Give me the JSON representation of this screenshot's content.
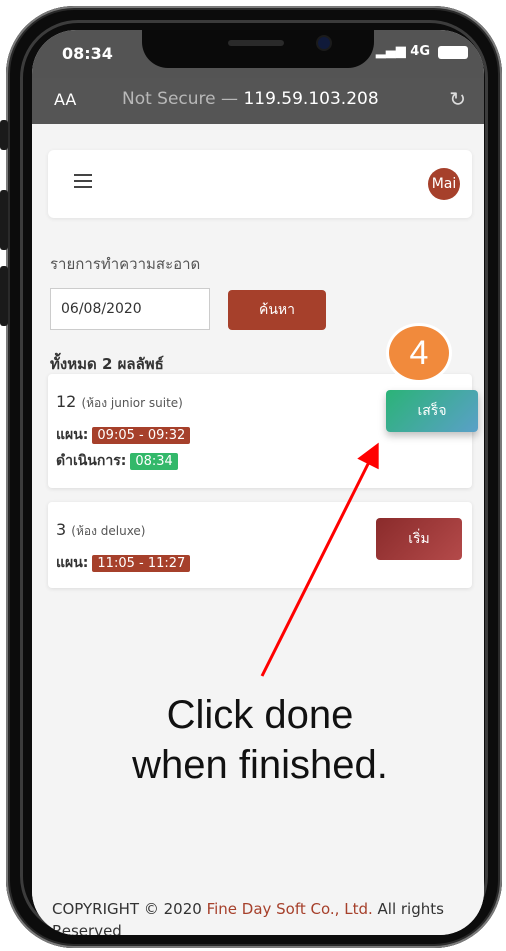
{
  "status_bar": {
    "time": "08:34",
    "network": "4G"
  },
  "browser": {
    "text_size_label": "AA",
    "security": "Not Secure",
    "separator": " — ",
    "address": "119.59.103.208"
  },
  "header": {
    "avatar_label": "Mai"
  },
  "page": {
    "title": "รายการทำความสะอาด",
    "date_value": "06/08/2020",
    "search_label": "ค้นหา",
    "total_label": "ทั้งหมด 2 ผลลัพธ์"
  },
  "tasks": [
    {
      "room": "12",
      "room_type": "(ห้อง junior suite)",
      "plan_label": "แผน:",
      "plan_time": "09:05 - 09:32",
      "progress_label": "ดำเนินการ:",
      "progress_time": "08:34",
      "action_label": "เสร็จ"
    },
    {
      "room": "3",
      "room_type": "(ห้อง deluxe)",
      "plan_label": "แผน:",
      "plan_time": "11:05 - 11:27",
      "action_label": "เริ่ม"
    }
  ],
  "footer": {
    "copyright": "COPYRIGHT © 2020 ",
    "company": "Fine Day Soft Co., Ltd.",
    "rights": " All rights Reserved"
  },
  "annotation": {
    "step_number": "4",
    "instruction_line1": "Click done",
    "instruction_line2": "when finished."
  },
  "colors": {
    "accent": "#a6402b",
    "success": "#33b86a",
    "step": "#f18a3c",
    "arrow": "#ff0000"
  },
  "icons": {
    "menu": "hamburger-icon",
    "reload": "reload-icon",
    "signal": "signal-icon",
    "battery": "battery-icon"
  }
}
